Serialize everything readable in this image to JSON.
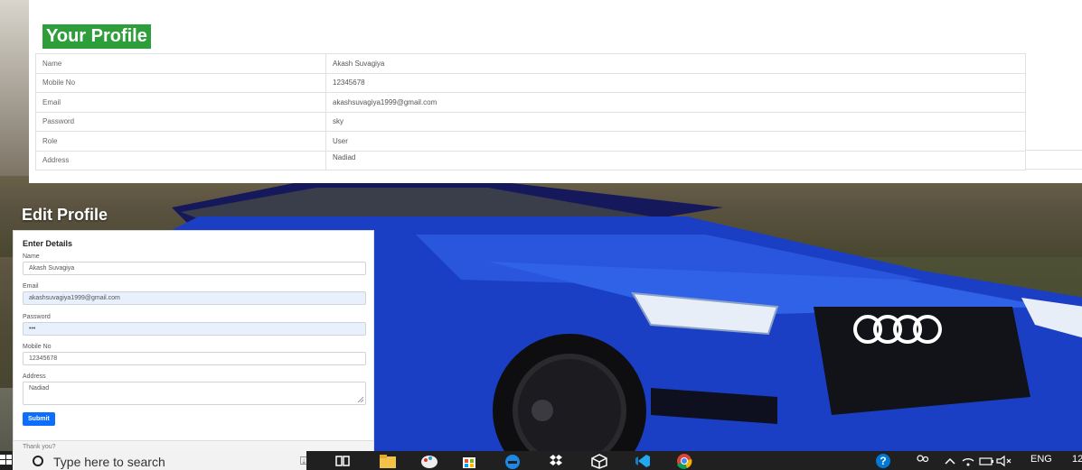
{
  "profile": {
    "title": "Your Profile",
    "rows": [
      {
        "key": "Name",
        "value": "Akash Suvagiya"
      },
      {
        "key": "Mobile No",
        "value": "12345678"
      },
      {
        "key": "Email",
        "value": "akashsuvagiya1999@gmail.com"
      },
      {
        "key": "Password",
        "value": "sky"
      },
      {
        "key": "Role",
        "value": "User"
      },
      {
        "key": "Address",
        "value": "Nadiad"
      }
    ]
  },
  "edit": {
    "title": "Edit Profile",
    "header": "Enter Details",
    "name_label": "Name",
    "name_value": "Akash Suvagiya",
    "email_label": "Email",
    "email_value": "akashsuvagiya1999@gmail.com",
    "password_label": "Password",
    "password_value": "•••",
    "mobile_label": "Mobile No",
    "mobile_value": "12345678",
    "address_label": "Address",
    "address_value": "Nadiad",
    "submit_label": "Submit",
    "footer_text": "Thank you?"
  },
  "taskbar": {
    "search_placeholder": "Type here to search",
    "lang": "ENG",
    "clock": "12"
  },
  "colors": {
    "profile_title_bg": "#2e9e3a",
    "submit_bg": "#0d6efd",
    "car_body": "#1b3fc4"
  }
}
